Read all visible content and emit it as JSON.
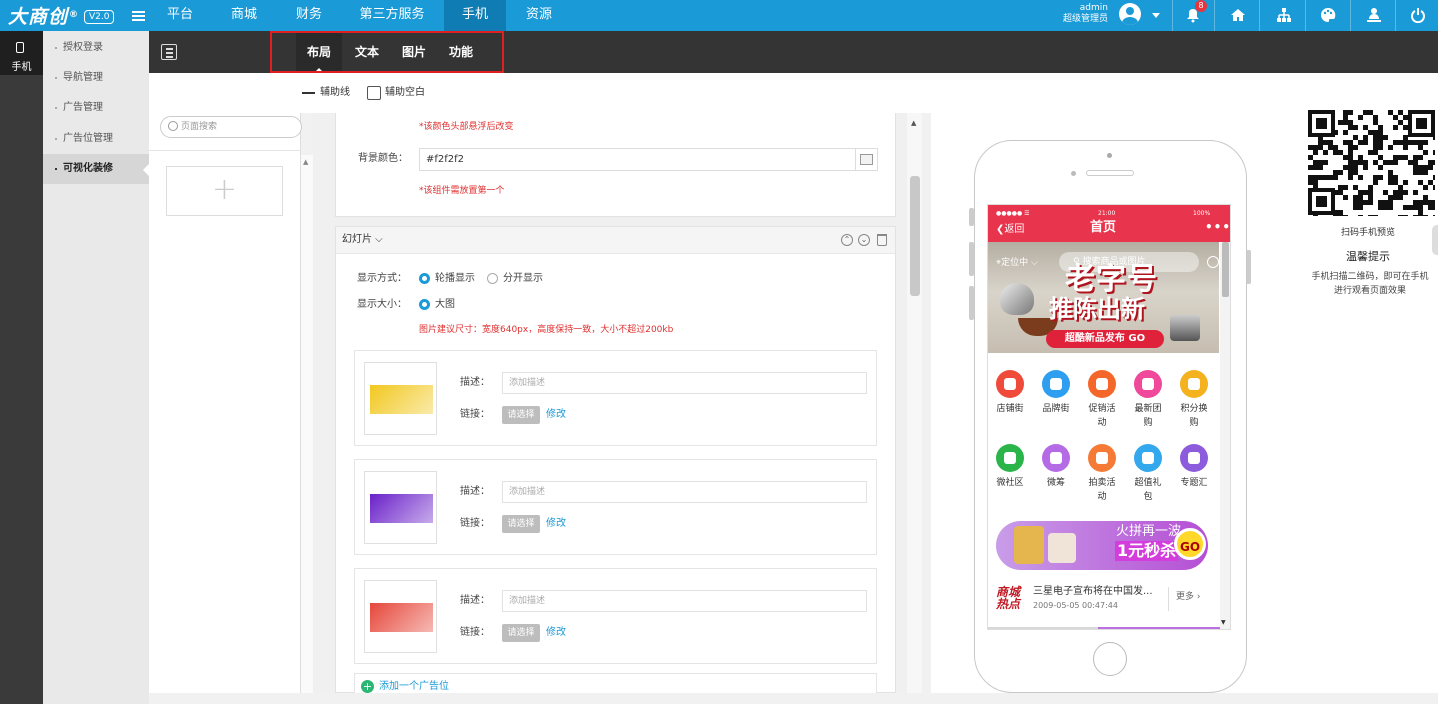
{
  "brand": {
    "name": "大商创",
    "reg": "®",
    "version": "V2.0"
  },
  "topnav": {
    "items": [
      {
        "label": "平台",
        "active": false
      },
      {
        "label": "商城",
        "active": false
      },
      {
        "label": "财务",
        "active": false
      },
      {
        "label": "第三方服务",
        "active": false
      },
      {
        "label": "手机",
        "active": true
      },
      {
        "label": "资源",
        "active": false
      }
    ],
    "user": {
      "name": "admin",
      "role": "超级管理员"
    },
    "notifications": "8",
    "icons": [
      "bell-icon",
      "home-icon",
      "sitemap-icon",
      "palette-icon",
      "user-tree-icon",
      "power-icon"
    ]
  },
  "leftnav": {
    "label": "手机",
    "icon": "phone-icon"
  },
  "sidebar": {
    "items": [
      {
        "label": "授权登录"
      },
      {
        "label": "导航管理"
      },
      {
        "label": "广告管理"
      },
      {
        "label": "广告位管理"
      },
      {
        "label": "可视化装修",
        "active": true
      }
    ]
  },
  "toolbar": {
    "tabs": [
      "布局",
      "文本",
      "图片",
      "功能"
    ],
    "active_tab": "布局"
  },
  "guides": {
    "line_label": "辅助线",
    "blank_label": "辅助空白",
    "blank_checked": false
  },
  "page_panel": {
    "search_placeholder": "页面搜索",
    "add_symbol": "+"
  },
  "editor": {
    "top_hint": "*该颜色头部悬浮后改变",
    "bg_label": "背景颜色：",
    "bg_value": "#f2f2f2",
    "bg_hint": "*该组件需放置第一个",
    "slider": {
      "title": "幻灯片",
      "display_mode_label": "显示方式：",
      "mode_options": [
        "轮播显示",
        "分开显示"
      ],
      "mode_selected": "轮播显示",
      "size_label": "显示大小：",
      "size_option": "大图",
      "size_hint": "图片建议尺寸：宽度640px，高度保持一致，大小不超过200kb",
      "slides": [
        {
          "desc_label": "描述：",
          "desc_placeholder": "添加描述",
          "link_label": "链接：",
          "choose": "请选择",
          "edit": "修改",
          "thumb_color": "#f2c81f"
        },
        {
          "desc_label": "描述：",
          "desc_placeholder": "添加描述",
          "link_label": "链接：",
          "choose": "请选择",
          "edit": "修改",
          "thumb_color": "#6a21c9"
        },
        {
          "desc_label": "描述：",
          "desc_placeholder": "添加描述",
          "link_label": "链接：",
          "choose": "请选择",
          "edit": "修改",
          "thumb_color": "#e6473a"
        }
      ],
      "add_slot": "添加一个广告位"
    }
  },
  "phone_preview": {
    "status_left": "●●●●● ☰",
    "status_time": "21:00",
    "status_right": "100%",
    "back_label": "返回",
    "title": "首页",
    "more": "•••",
    "location": "定位中",
    "search_placeholder": "搜索商品或图片",
    "banner_line1": "老字号",
    "banner_line2": "推陈出新",
    "banner_pill": "超酷新品发布 GO",
    "icons": [
      {
        "label": "店铺街",
        "color": "#f04a3b"
      },
      {
        "label": "品牌街",
        "color": "#2e9ef0"
      },
      {
        "label": "促销活动",
        "color": "#f5662a"
      },
      {
        "label": "最新团购",
        "color": "#f0489a"
      },
      {
        "label": "积分换购",
        "color": "#f3b21e"
      },
      {
        "label": "微社区",
        "color": "#2bb44a"
      },
      {
        "label": "微筹",
        "color": "#b56ae6"
      },
      {
        "label": "拍卖活动",
        "color": "#f47a36"
      },
      {
        "label": "超值礼包",
        "color": "#33a8ec"
      },
      {
        "label": "专题汇",
        "color": "#8c5cdc"
      }
    ],
    "promo_line1": "火拼再一波",
    "promo_line2": "1元秒杀",
    "promo_go": "GO",
    "news_logo": "商城热点",
    "news_title": "三星电子宣布将在中国发...",
    "news_date": "2009-05-05 00:47:44",
    "news_more": "更多 ›"
  },
  "right_panel": {
    "qr_caption": "扫码手机预览",
    "tip_title": "温馨提示",
    "tip_text": "手机扫描二维码，即可在手机进行观看页面效果"
  }
}
